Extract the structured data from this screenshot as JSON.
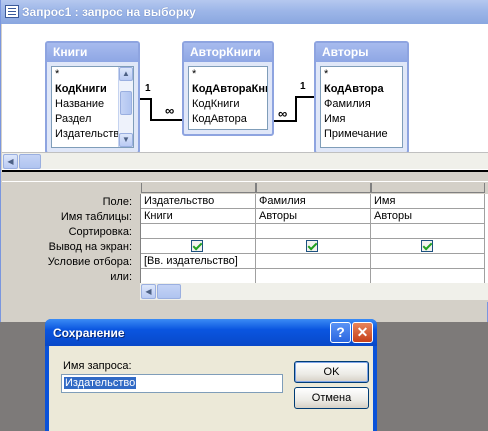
{
  "window": {
    "title": "Запрос1 : запрос на выборку"
  },
  "tables": [
    {
      "name": "Книги",
      "fields": [
        "*",
        "КодКниги",
        "Название",
        "Раздел",
        "Издательство"
      ]
    },
    {
      "name": "АвторКниги",
      "fields": [
        "*",
        "КодАвтораКниг",
        "КодКниги",
        "КодАвтора"
      ]
    },
    {
      "name": "Авторы",
      "fields": [
        "*",
        "КодАвтора",
        "Фамилия",
        "Имя",
        "Примечание"
      ]
    }
  ],
  "relations": [
    {
      "one_label": "1",
      "many_label": "∞"
    },
    {
      "one_label": "1",
      "many_label": "∞"
    }
  ],
  "grid": {
    "row_labels": [
      "Поле:",
      "Имя таблицы:",
      "Сортировка:",
      "Вывод на экран:",
      "Условие отбора:",
      "или:"
    ],
    "columns": [
      {
        "field": "Издательство",
        "table": "Книги",
        "sort": "",
        "show": true,
        "criteria": "[Вв. издательство]",
        "or": ""
      },
      {
        "field": "Фамилия",
        "table": "Авторы",
        "sort": "",
        "show": true,
        "criteria": "",
        "or": ""
      },
      {
        "field": "Имя",
        "table": "Авторы",
        "sort": "",
        "show": true,
        "criteria": "",
        "or": ""
      }
    ]
  },
  "dialog": {
    "title": "Сохранение",
    "help_label": "?",
    "close_label": "✕",
    "prompt": "Имя запроса:",
    "input_value": "Издательство",
    "ok_label": "OK",
    "cancel_label": "Отмена"
  },
  "colors": {
    "window_title_inactive": "#9db6e8",
    "dialog_title_active": "#0a55e0",
    "selection": "#316ac5",
    "checkmark": "#21a121"
  }
}
